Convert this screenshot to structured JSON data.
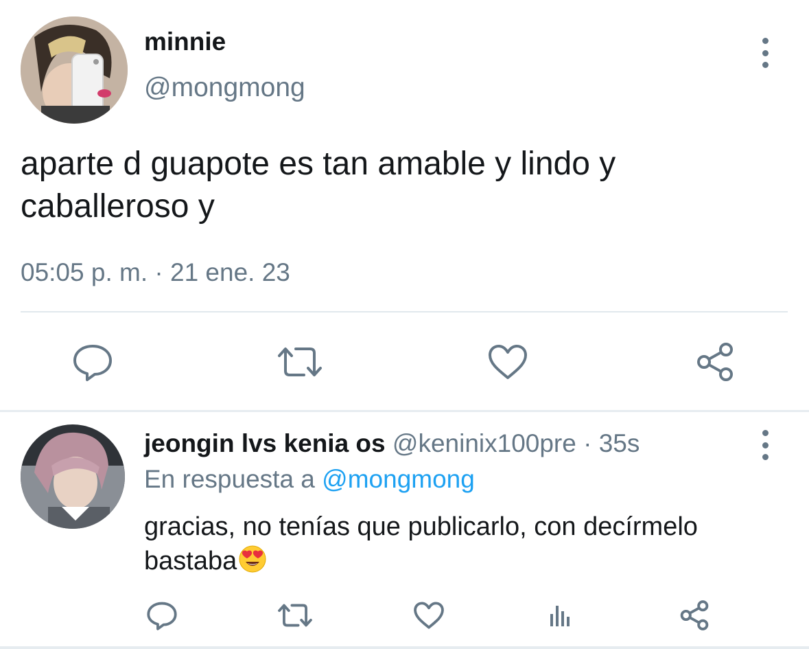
{
  "main_tweet": {
    "author_name": "minnie",
    "author_handle": "@mongmong",
    "text": "aparte d guapote es tan amable y lindo y caballeroso y",
    "timestamp": "05:05 p. m. · 21 ene. 23",
    "actions": [
      "reply-icon",
      "retweet-icon",
      "like-icon",
      "share-icon"
    ]
  },
  "reply": {
    "author_name": "jeongin lvs kenia os",
    "author_handle": "@keninix100pre",
    "separator": "·",
    "time_ago": "35s",
    "in_reply_prefix": "En respuesta a",
    "in_reply_handle": "@mongmong",
    "text": "gracias, no tenías que publicarlo, con decírmelo bastaba",
    "emoji": "heart-eyes-emoji",
    "actions": [
      "reply-icon",
      "retweet-icon",
      "like-icon",
      "analytics-icon",
      "share-icon"
    ]
  },
  "colors": {
    "text_primary": "#14171a",
    "text_secondary": "#657786",
    "link": "#1da1f2",
    "divider": "#e1e8ed"
  }
}
